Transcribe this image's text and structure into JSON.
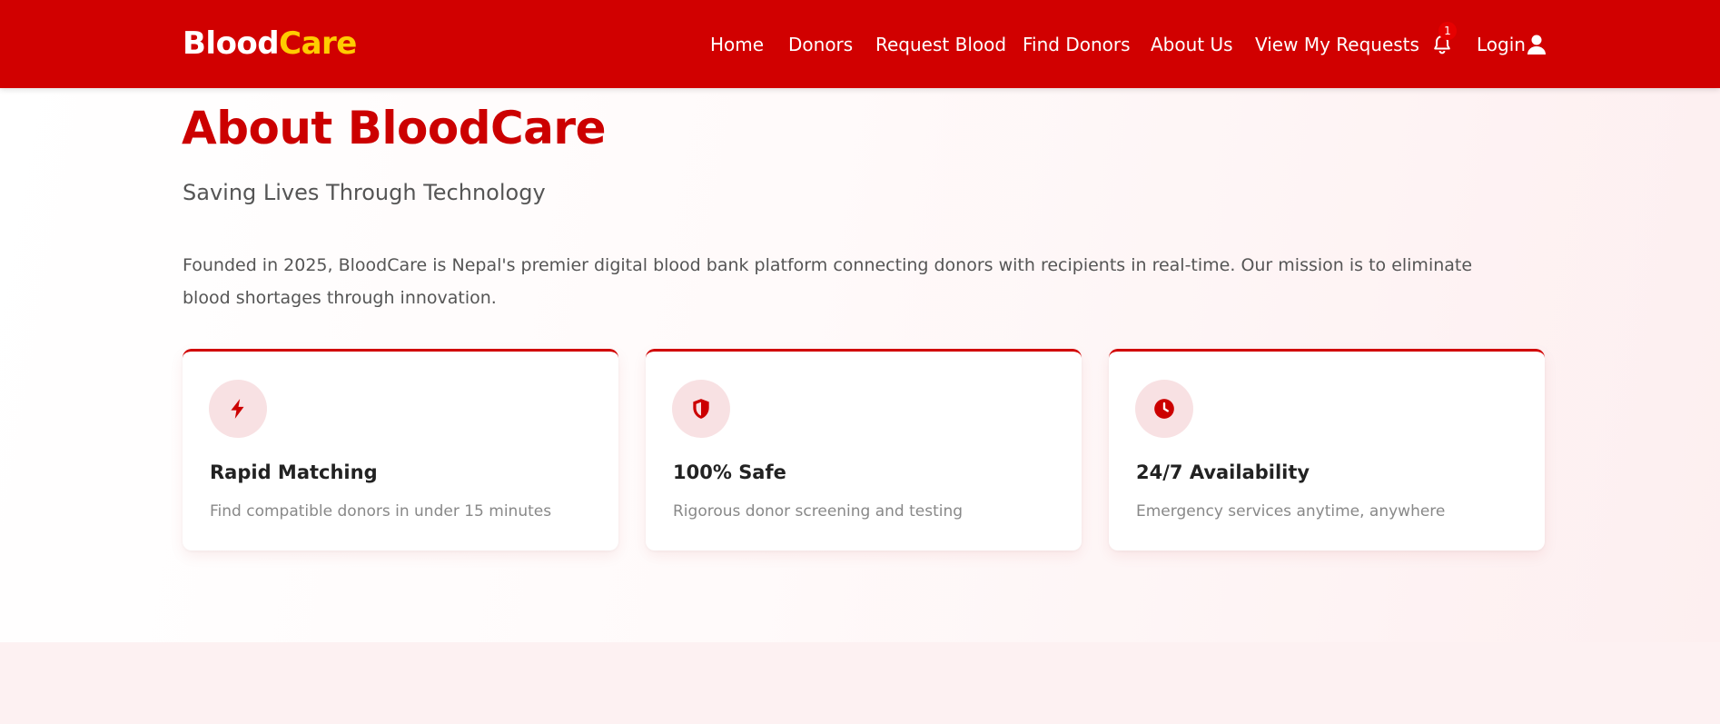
{
  "brand": {
    "part1": "Blood",
    "part2": "Care",
    "accent_color": "#ffcc00"
  },
  "nav": {
    "items": [
      "Home",
      "Donors",
      "Request Blood",
      "Find Donors",
      "About Us",
      "View My Requests"
    ],
    "notification_icon": "bell-icon",
    "notification_count": "1",
    "login_label": "Login",
    "login_icon": "user-icon"
  },
  "about": {
    "title": "About BloodCare",
    "subtitle": "Saving Lives Through Technology",
    "description": "Founded in 2025, BloodCare is Nepal's premier digital blood bank platform connecting donors with recipients in real-time. Our mission is to eliminate blood shortages through innovation."
  },
  "features": [
    {
      "icon": "lightning-bolt-icon",
      "title": "Rapid Matching",
      "text": "Find compatible donors in under 15 minutes"
    },
    {
      "icon": "shield-icon",
      "title": "100% Safe",
      "text": "Rigorous donor screening and testing"
    },
    {
      "icon": "clock-icon",
      "title": "24/7 Availability",
      "text": "Emergency services anytime, anywhere"
    }
  ],
  "colors": {
    "primary": "#d10000",
    "title_red": "#cc0000",
    "icon_bg": "#f8e1e3"
  }
}
